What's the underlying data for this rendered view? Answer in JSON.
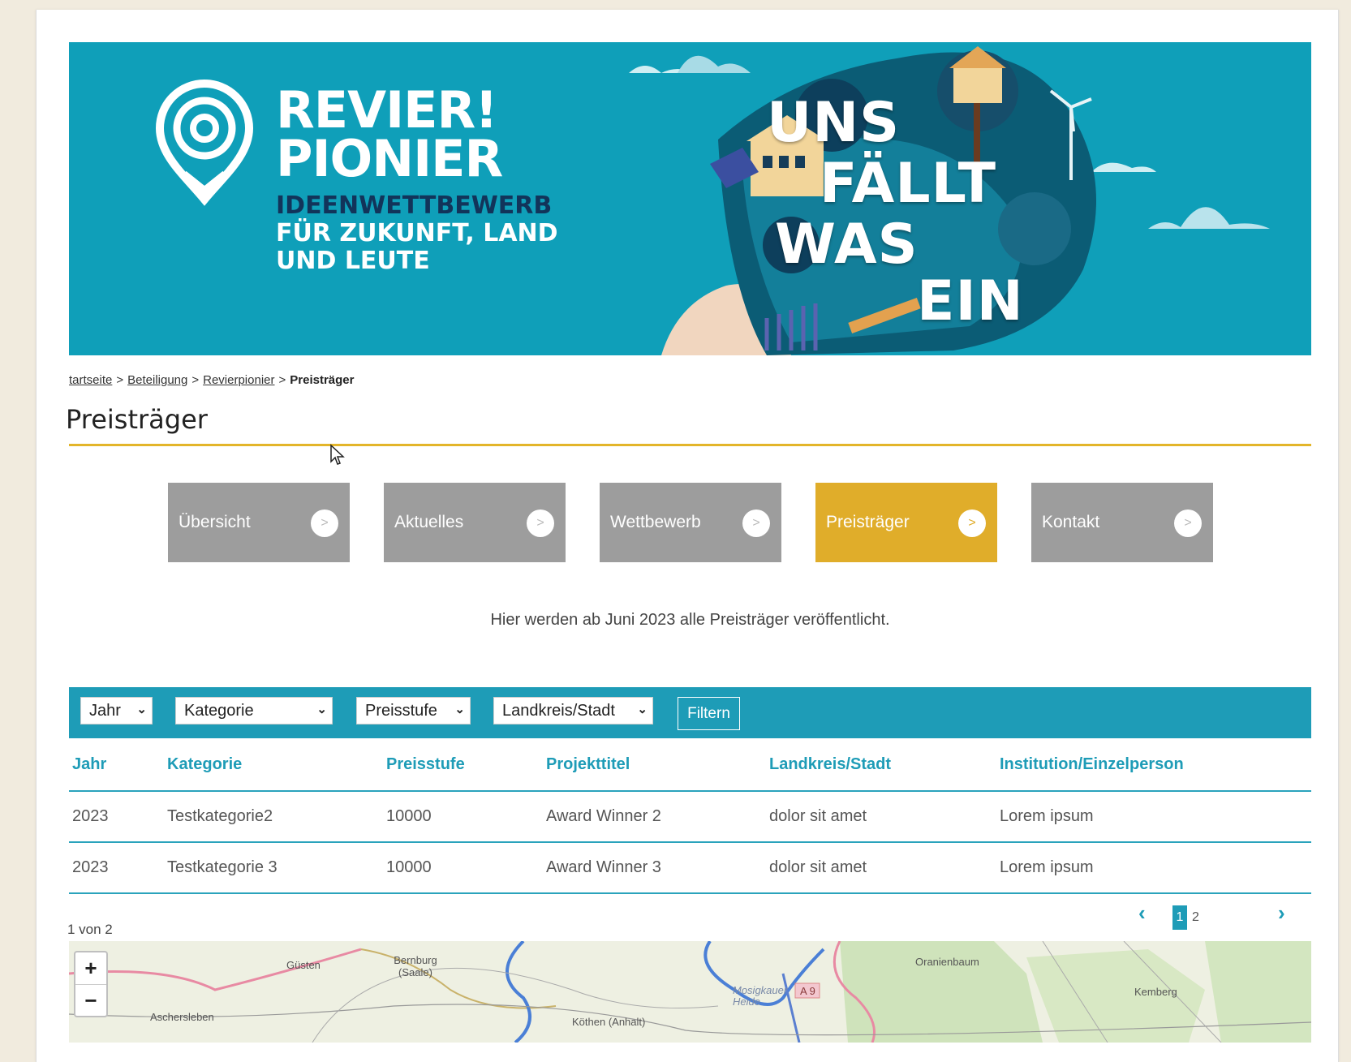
{
  "banner": {
    "logo_line1": "REVIER!",
    "logo_line2": "PIONIER",
    "logo_sub1": "IDEENWETTBEWERB",
    "logo_sub2": "FÜR ZUKUNFT, LAND",
    "logo_sub3": "UND LEUTE",
    "slogan1": "UNS",
    "slogan2": "FÄLLT",
    "slogan3": "WAS",
    "slogan4": "EIN"
  },
  "breadcrumb": {
    "items": [
      "tartseite",
      "Beteiligung",
      "Revierpionier"
    ],
    "current": "Preisträger",
    "separator": ">"
  },
  "page_title": "Preisträger",
  "tiles": [
    {
      "label": "Übersicht",
      "arrow": ">",
      "active": false
    },
    {
      "label": "Aktuelles",
      "arrow": ">",
      "active": false
    },
    {
      "label": "Wettbewerb",
      "arrow": ">",
      "active": false
    },
    {
      "label": "Preisträger",
      "arrow": ">",
      "active": true
    },
    {
      "label": "Kontakt",
      "arrow": ">",
      "active": false
    }
  ],
  "intro_text": "Hier werden ab Juni 2023 alle Preisträger veröffentlicht.",
  "filters": {
    "jahr": "Jahr",
    "kategorie": "Kategorie",
    "preisstufe": "Preisstufe",
    "landkreis": "Landkreis/Stadt",
    "button": "Filtern"
  },
  "table": {
    "headers": [
      "Jahr",
      "Kategorie",
      "Preisstufe",
      "Projekttitel",
      "Landkreis/Stadt",
      "Institution/Einzelperson"
    ],
    "rows": [
      [
        "2023",
        "Testkategorie2",
        "10000",
        "Award Winner 2",
        "dolor sit amet",
        "Lorem ipsum"
      ],
      [
        "2023",
        "Testkategorie 3",
        "10000",
        "Award Winner 3",
        "dolor sit amet",
        "Lorem ipsum"
      ]
    ]
  },
  "pagination": {
    "info": "1 von 2",
    "pages": [
      "1",
      "2"
    ],
    "prev": "‹",
    "next": "›"
  },
  "map": {
    "zoom_in": "+",
    "zoom_out": "−",
    "labels": [
      "Güsten",
      "Bernburg (Saale)",
      "Aschersleben",
      "Köthen (Anhalt)",
      "Mosigkauer Heide",
      "A 9",
      "Oranienbaum",
      "Kemberg"
    ]
  },
  "colors": {
    "brand_teal": "#0f9fb9",
    "accent_gold": "#e0ad2a",
    "tile_grey": "#9d9d9d",
    "navy": "#12345a"
  }
}
